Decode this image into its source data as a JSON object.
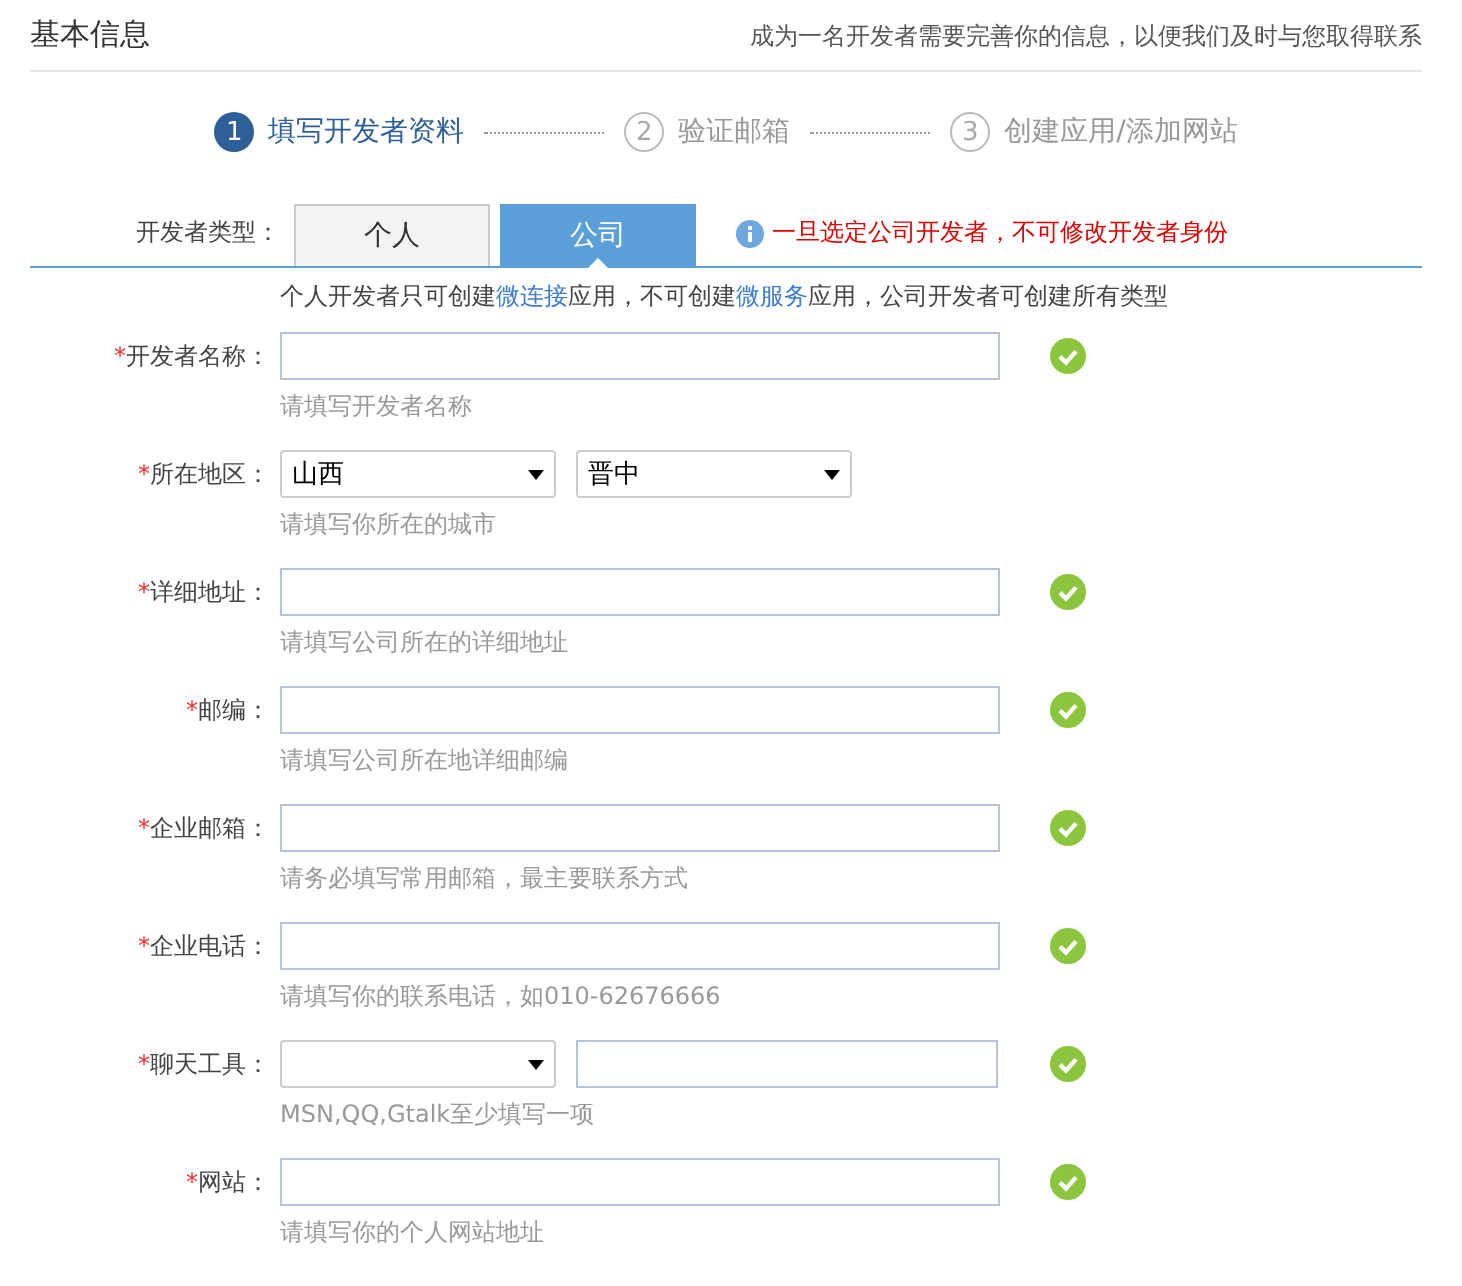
{
  "header": {
    "title": "基本信息",
    "subtitle": "成为一名开发者需要完善你的信息，以便我们及时与您取得联系"
  },
  "steps": [
    {
      "number": "1",
      "label": "填写开发者资料",
      "selected": true
    },
    {
      "number": "2",
      "label": "验证邮箱",
      "selected": false
    },
    {
      "number": "3",
      "label": "创建应用/添加网站",
      "selected": false
    }
  ],
  "developer_type": {
    "label": "开发者类型：",
    "tabs": [
      {
        "label": "个人",
        "selected": false
      },
      {
        "label": "公司",
        "selected": true
      }
    ],
    "warning": "一旦选定公司开发者，不可修改开发者身份"
  },
  "note": [
    {
      "kind": "plain",
      "text": "个人开发者只可创建"
    },
    {
      "kind": "link",
      "text": "微连接"
    },
    {
      "kind": "plain",
      "text": "应用，不可创建"
    },
    {
      "kind": "link",
      "text": "微服务"
    },
    {
      "kind": "plain",
      "text": "应用，公司开发者可创建所有类型"
    }
  ],
  "fields": [
    {
      "kind": "text",
      "label": "开发者名称：",
      "marker": "*",
      "hint": "请填写开发者名称",
      "valid": true
    },
    {
      "kind": "region",
      "label": "所在地区：",
      "marker": "*",
      "selects": [
        "山西",
        "晋中"
      ],
      "hint": "请填写你所在的城市",
      "valid": false
    },
    {
      "kind": "text",
      "label": "详细地址：",
      "marker": "*",
      "hint": "请填写公司所在的详细地址",
      "valid": true
    },
    {
      "kind": "text",
      "label": "邮编：",
      "marker": "*",
      "hint": "请填写公司所在地详细邮编",
      "valid": true
    },
    {
      "kind": "text",
      "label": "企业邮箱：",
      "marker": "*",
      "hint": "请务必填写常用邮箱，最主要联系方式",
      "valid": true
    },
    {
      "kind": "text",
      "label": "企业电话：",
      "marker": "*",
      "hint": "请填写你的联系电话，如010-62676666",
      "valid": true
    },
    {
      "kind": "chat",
      "label": "聊天工具：",
      "marker": "*",
      "hint": "MSN,QQ,Gtalk至少填写一项",
      "valid": true
    },
    {
      "kind": "text",
      "label": "网站：",
      "marker": "*",
      "hint": "请填写你的个人网站地址",
      "valid": true
    }
  ]
}
